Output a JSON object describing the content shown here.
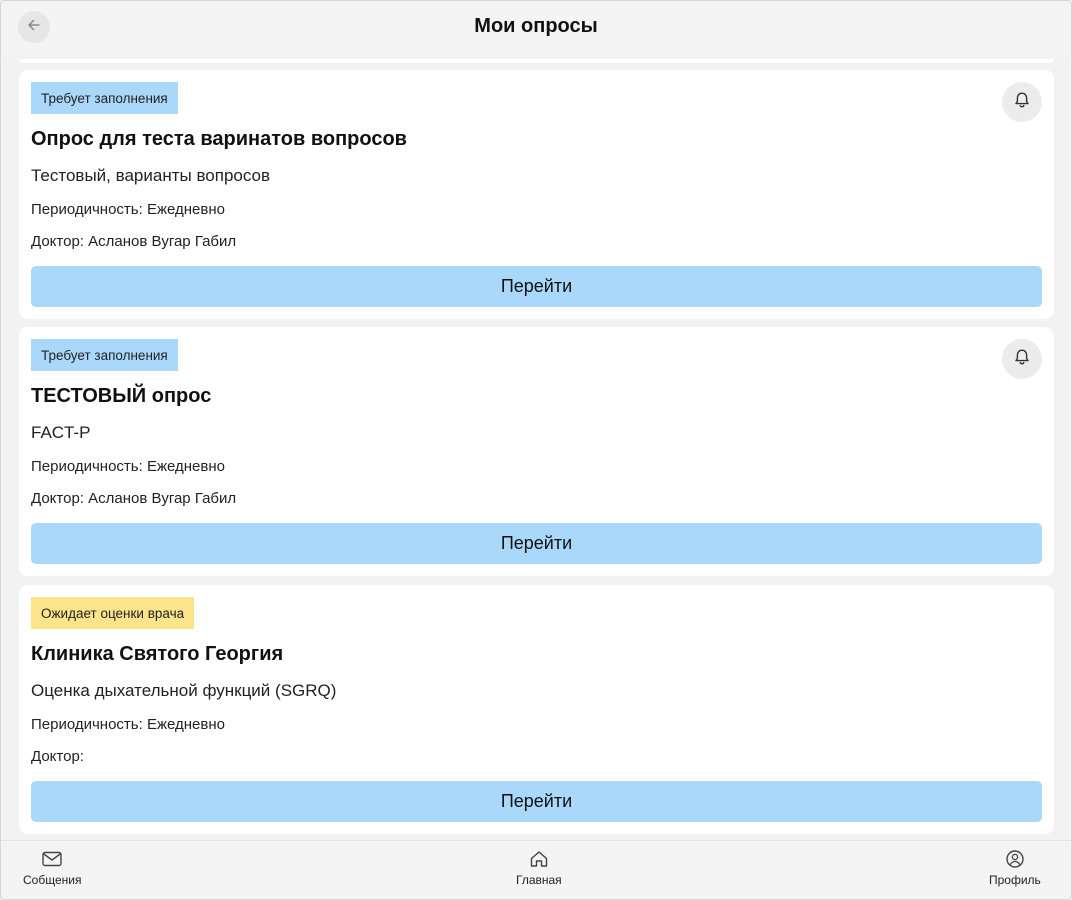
{
  "header": {
    "title": "Мои опросы",
    "back_icon": "arrow-left-icon"
  },
  "surveys": [
    {
      "status": "Требует заполнения",
      "status_color": "#a9d8fb",
      "has_bell": true,
      "title": "Опрос для теста варинатов вопросов",
      "subtitle": "Тестовый, варианты вопросов",
      "periodicity": "Периодичность: Ежедневно",
      "doctor": "Доктор: Асланов Вугар Габил",
      "button_label": "Перейти"
    },
    {
      "status": "Требует заполнения",
      "status_color": "#a9d8fb",
      "has_bell": true,
      "title": "ТЕСТОВЫЙ опрос",
      "subtitle": "FACT-P",
      "periodicity": "Периодичность: Ежедневно",
      "doctor": "Доктор: Асланов Вугар Габил",
      "button_label": "Перейти"
    },
    {
      "status": "Ожидает оценки врача",
      "status_color": "#fbe489",
      "has_bell": false,
      "title": "Клиника Святого Георгия",
      "subtitle": "Оценка дыхательной функций (SGRQ)",
      "periodicity": "Периодичность: Ежедневно",
      "doctor": "Доктор:",
      "button_label": "Перейти"
    }
  ],
  "bottom_nav": {
    "items": [
      {
        "label": "Собщения",
        "icon": "mail-icon"
      },
      {
        "label": "Главная",
        "icon": "home-icon"
      },
      {
        "label": "Профиль",
        "icon": "profile-icon"
      }
    ]
  },
  "colors": {
    "button_bg": "#a9d8fb",
    "badge_required": "#a9d8fb",
    "badge_waiting": "#fbe489",
    "page_bg": "#f2f2f2",
    "card_bg": "#ffffff"
  }
}
